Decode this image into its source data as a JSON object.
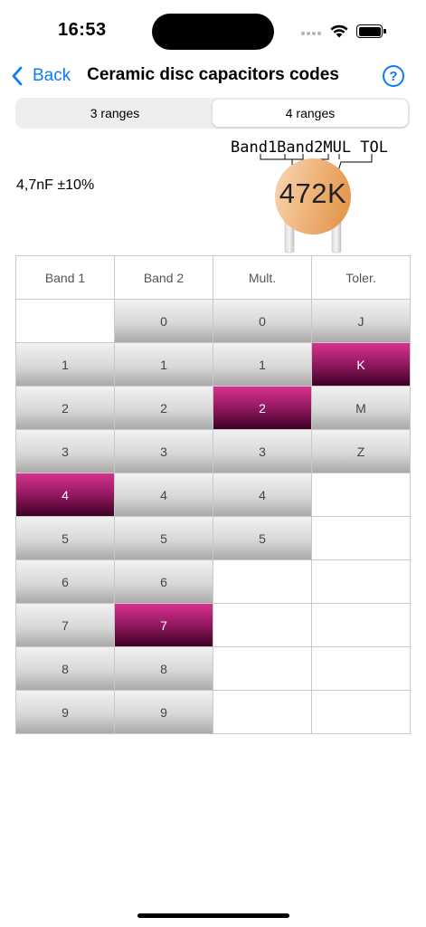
{
  "status": {
    "time": "16:53"
  },
  "nav": {
    "back_label": "Back",
    "title": "Ceramic disc capacitors codes",
    "help_label": "?"
  },
  "tabs": [
    {
      "label": "3 ranges",
      "selected": false
    },
    {
      "label": "4 ranges",
      "selected": true
    }
  ],
  "value_display": "4,7nF ±10%",
  "band_labels": "Band1Band2MUL TOL",
  "capacitor_code": "472K",
  "colors": {
    "accent": "#0a7aff",
    "selected_cell": "#9a1a65",
    "capacitor": "#eba869"
  },
  "table": {
    "headers": [
      "Band 1",
      "Band 2",
      "Mult.",
      "Toler."
    ],
    "rows": [
      [
        {
          "label": "",
          "kind": "empty"
        },
        {
          "label": "0",
          "kind": "btn"
        },
        {
          "label": "0",
          "kind": "btn"
        },
        {
          "label": "J",
          "kind": "btn"
        }
      ],
      [
        {
          "label": "1",
          "kind": "btn"
        },
        {
          "label": "1",
          "kind": "btn"
        },
        {
          "label": "1",
          "kind": "btn"
        },
        {
          "label": "K",
          "kind": "sel"
        }
      ],
      [
        {
          "label": "2",
          "kind": "btn"
        },
        {
          "label": "2",
          "kind": "btn"
        },
        {
          "label": "2",
          "kind": "sel"
        },
        {
          "label": "M",
          "kind": "btn"
        }
      ],
      [
        {
          "label": "3",
          "kind": "btn"
        },
        {
          "label": "3",
          "kind": "btn"
        },
        {
          "label": "3",
          "kind": "btn"
        },
        {
          "label": "Z",
          "kind": "btn"
        }
      ],
      [
        {
          "label": "4",
          "kind": "sel"
        },
        {
          "label": "4",
          "kind": "btn"
        },
        {
          "label": "4",
          "kind": "btn"
        },
        {
          "label": "",
          "kind": "empty"
        }
      ],
      [
        {
          "label": "5",
          "kind": "btn"
        },
        {
          "label": "5",
          "kind": "btn"
        },
        {
          "label": "5",
          "kind": "btn"
        },
        {
          "label": "",
          "kind": "empty"
        }
      ],
      [
        {
          "label": "6",
          "kind": "btn"
        },
        {
          "label": "6",
          "kind": "btn"
        },
        {
          "label": "",
          "kind": "empty"
        },
        {
          "label": "",
          "kind": "empty"
        }
      ],
      [
        {
          "label": "7",
          "kind": "btn"
        },
        {
          "label": "7",
          "kind": "sel"
        },
        {
          "label": "",
          "kind": "empty"
        },
        {
          "label": "",
          "kind": "empty"
        }
      ],
      [
        {
          "label": "8",
          "kind": "btn"
        },
        {
          "label": "8",
          "kind": "btn"
        },
        {
          "label": "",
          "kind": "empty"
        },
        {
          "label": "",
          "kind": "empty"
        }
      ],
      [
        {
          "label": "9",
          "kind": "btn"
        },
        {
          "label": "9",
          "kind": "btn"
        },
        {
          "label": "",
          "kind": "empty"
        },
        {
          "label": "",
          "kind": "empty"
        }
      ]
    ]
  }
}
